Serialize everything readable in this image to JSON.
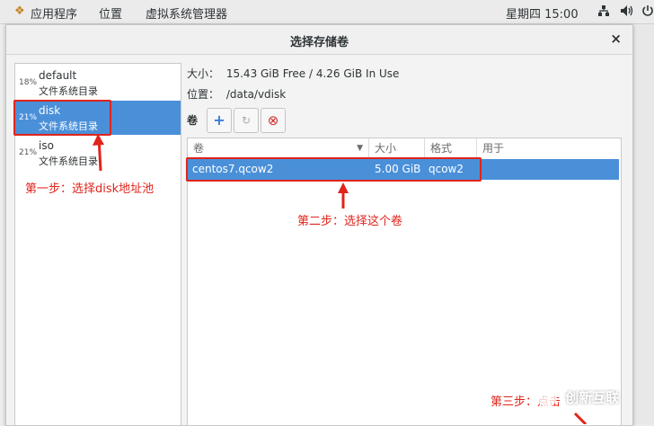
{
  "topbar": {
    "apps": "应用程序",
    "places": "位置",
    "app_title": "虚拟系统管理器",
    "clock": "星期四 15:00"
  },
  "dialog": {
    "title": "选择存储卷",
    "close": "×"
  },
  "pools": [
    {
      "pct": "18%",
      "name": "default",
      "type": "文件系统目录"
    },
    {
      "pct": "21%",
      "name": "disk",
      "type": "文件系统目录"
    },
    {
      "pct": "21%",
      "name": "iso",
      "type": "文件系统目录"
    }
  ],
  "info": {
    "size_label": "大小：",
    "size_value": "15.43 GiB Free / 4.26 GiB In Use",
    "location_label": "位置：",
    "location_value": "/data/vdisk"
  },
  "toolbar": {
    "label": "卷",
    "add": "+",
    "refresh": "↻",
    "delete": "⊗"
  },
  "table": {
    "headers": [
      "卷",
      "大小",
      "格式",
      "用于"
    ],
    "rows": [
      {
        "name": "centos7.qcow2",
        "size": "5.00 GiB",
        "format": "qcow2",
        "used": ""
      }
    ]
  },
  "annotations": {
    "step1": "第一步：选择disk地址池",
    "step2": "第二步：选择这个卷",
    "step3": "第三步：点击"
  },
  "watermark": "创新互联",
  "colors": {
    "selection": "#4a90d9",
    "annotation": "#e0241b"
  }
}
